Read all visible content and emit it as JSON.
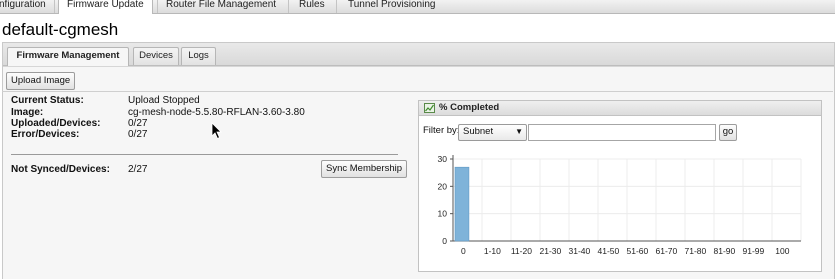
{
  "nav": {
    "items": [
      "nfiguration",
      "Firmware Update",
      "Router File Management",
      "Rules",
      "Tunnel Provisioning"
    ],
    "active_index": 1
  },
  "page": {
    "title": "default-cgmesh"
  },
  "tabs": [
    {
      "label": "Firmware Management",
      "active": true
    },
    {
      "label": "Devices",
      "active": false
    },
    {
      "label": "Logs",
      "active": false
    }
  ],
  "toolbar": {
    "upload_label": "Upload Image"
  },
  "status": {
    "current_status_label": "Current Status:",
    "current_status_value": "Upload Stopped",
    "image_label": "Image:",
    "image_value": "cg-mesh-node-5.5.80-RFLAN-3.60-3.80",
    "uploaded_label": "Uploaded/Devices:",
    "uploaded_value": "0/27",
    "error_label": "Error/Devices:",
    "error_value": "0/27",
    "not_synced_label": "Not Synced/Devices:",
    "not_synced_value": "2/27",
    "sync_button_label": "Sync Membership"
  },
  "chart_panel": {
    "title": "% Completed",
    "filter_label": "Filter by:",
    "filter_selected": "Subnet",
    "filter_value": "",
    "go_label": "go"
  },
  "chart_data": {
    "type": "bar",
    "categories": [
      "0",
      "1-10",
      "11-20",
      "21-30",
      "31-40",
      "41-50",
      "51-60",
      "61-70",
      "71-80",
      "81-90",
      "91-99",
      "100"
    ],
    "values": [
      27,
      0,
      0,
      0,
      0,
      0,
      0,
      0,
      0,
      0,
      0,
      0
    ],
    "yticks": [
      0,
      10,
      20,
      30
    ],
    "ylim": [
      0,
      30
    ],
    "grid": true,
    "bar_color": "#7fb3d9"
  }
}
